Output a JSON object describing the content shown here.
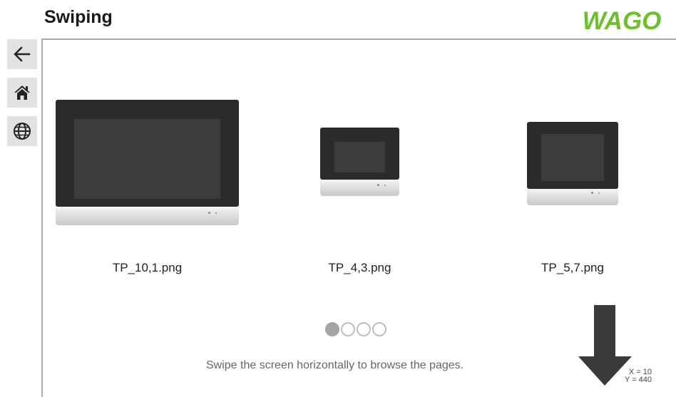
{
  "header": {
    "title": "Swiping",
    "logo_text": "WAGO",
    "logo_color": "#6ebe2e"
  },
  "sidebar": {
    "items": [
      {
        "name": "back-button",
        "icon": "arrow-left-icon"
      },
      {
        "name": "home-button",
        "icon": "home-icon"
      },
      {
        "name": "language-button",
        "icon": "globe-icon"
      }
    ]
  },
  "gallery": {
    "items": [
      {
        "caption": "TP_10,1.png"
      },
      {
        "caption": "TP_4,3.png"
      },
      {
        "caption": "TP_5,7.png"
      }
    ]
  },
  "pager": {
    "count": 4,
    "active_index": 0
  },
  "hint": "Swipe the screen horizontally to browse the pages.",
  "readout": {
    "x": "X = 10",
    "y": "Y = 440"
  },
  "colors": {
    "frame": "#a9a9a9",
    "sidebar_button": "#e2e2e2",
    "arrow": "#3a3a3a",
    "pager_active": "#a5a5a5"
  }
}
